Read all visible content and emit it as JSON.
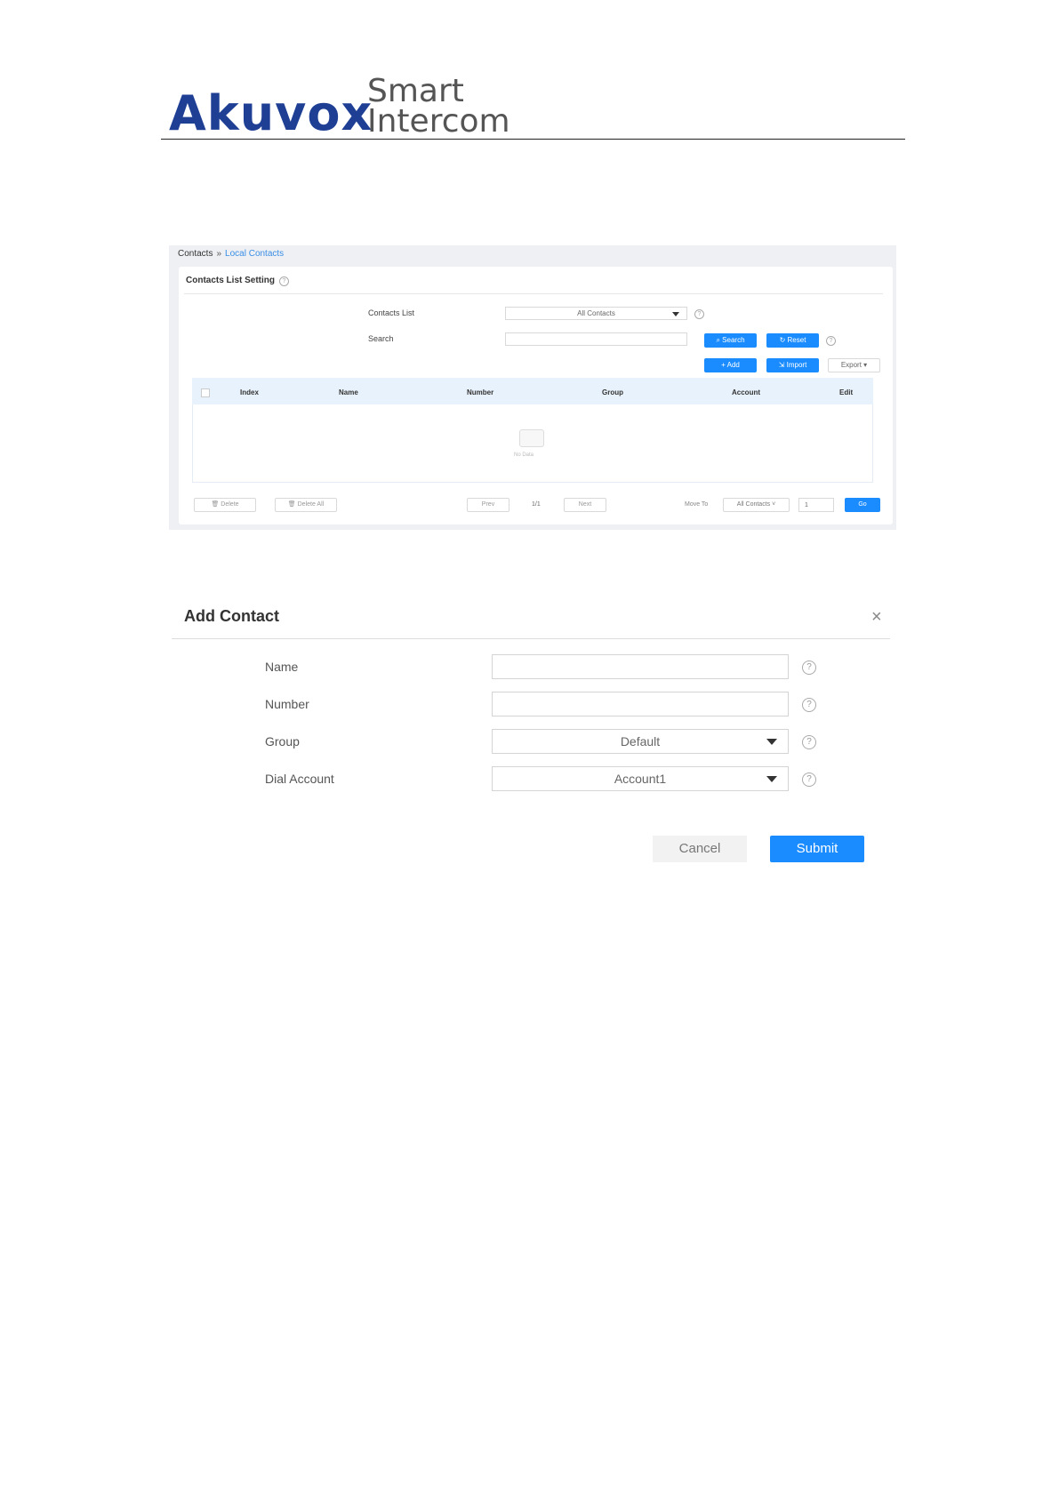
{
  "header": {
    "brand": "Akuvox",
    "tagline_line1": "Smart",
    "tagline_line2": "Intercom"
  },
  "contacts_page": {
    "breadcrumb_root": "Contacts",
    "breadcrumb_sep": "»",
    "breadcrumb_current": "Local Contacts",
    "section_title": "Contacts List Setting",
    "contacts_list_label": "Contacts List",
    "contacts_list_value": "All Contacts",
    "search_label": "Search",
    "search_value": "",
    "search_button": "Search",
    "reset_button": "Reset",
    "add_button": "Add",
    "import_button": "Import",
    "export_button": "Export",
    "table_headers": [
      "Index",
      "Name",
      "Number",
      "Group",
      "Account",
      "Edit"
    ],
    "no_data": "No Data",
    "delete_button": "Delete",
    "delete_all_button": "Delete All",
    "prev_button": "Prev",
    "page_indicator": "1/1",
    "next_button": "Next",
    "move_to_label": "Move To",
    "move_to_value": "All Contacts",
    "page_input_value": "1",
    "go_button": "Go"
  },
  "add_contact": {
    "title": "Add Contact",
    "close_glyph": "×",
    "fields": [
      {
        "label": "Name",
        "value": ""
      },
      {
        "label": "Number",
        "value": ""
      },
      {
        "label": "Group",
        "value": "Default"
      },
      {
        "label": "Dial Account",
        "value": "Account1"
      }
    ],
    "cancel_button": "Cancel",
    "submit_button": "Submit"
  },
  "colors": {
    "brand_blue": "#1f3f95",
    "accent_blue": "#1a8cff",
    "link_blue": "#3a8ee6"
  }
}
